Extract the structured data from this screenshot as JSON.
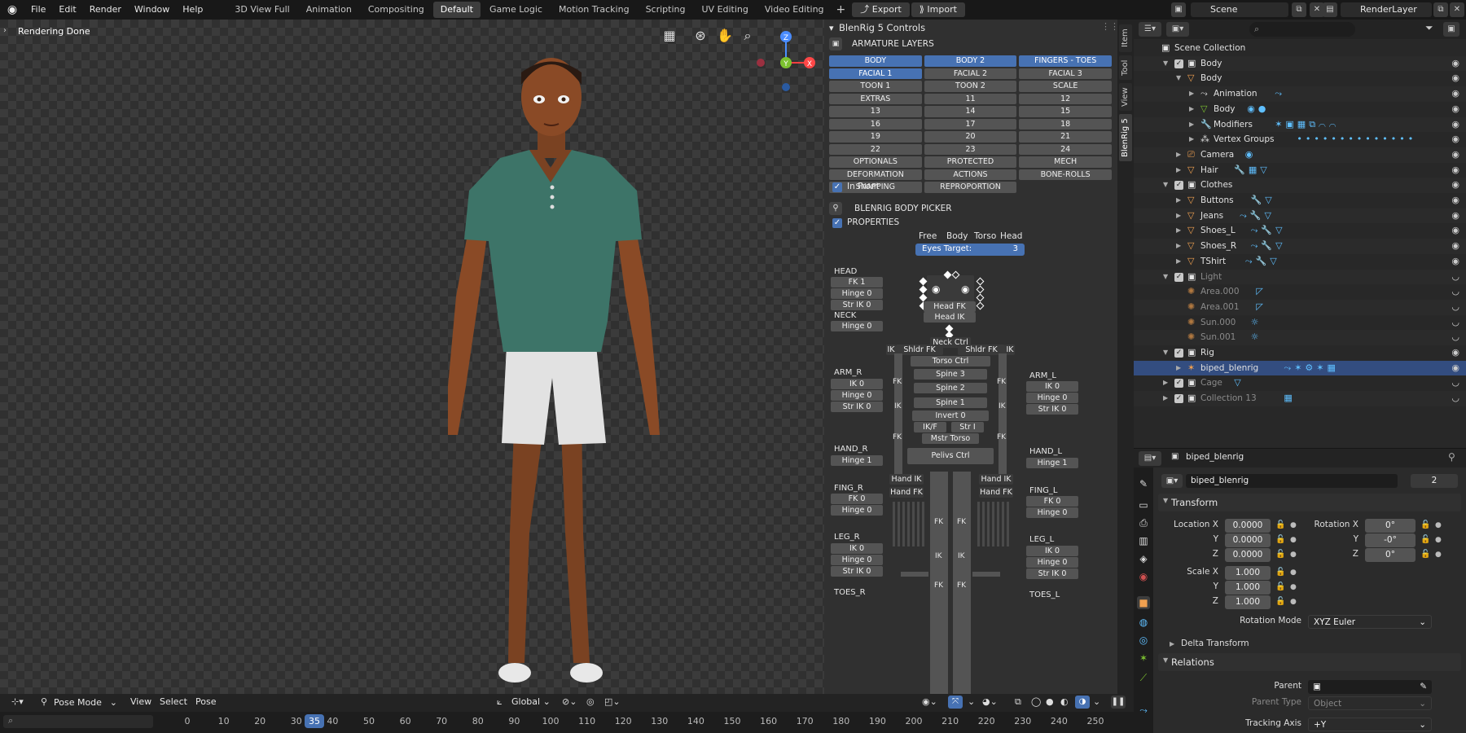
{
  "menu": [
    "File",
    "Edit",
    "Render",
    "Window",
    "Help"
  ],
  "workspaces": [
    "3D View Full",
    "Animation",
    "Compositing",
    "Default",
    "Game Logic",
    "Motion Tracking",
    "Scripting",
    "UV Editing",
    "Video Editing"
  ],
  "active_workspace": "Default",
  "toolbar_buttons": {
    "export": "Export",
    "import": "Import"
  },
  "scene": "Scene",
  "view_layer": "RenderLayer",
  "viewport": {
    "status": "Rendering Done",
    "gizmo": {
      "z": "Z",
      "y": "Y",
      "x": "X"
    }
  },
  "npanel": {
    "title": "BlenRig 5 Controls",
    "tabs": [
      "Item",
      "Tool",
      "View",
      "BlenRig 5"
    ],
    "armature_layers_title": "ARMATURE LAYERS",
    "layers": [
      {
        "label": "BODY",
        "on": true
      },
      {
        "label": "BODY 2",
        "on": true
      },
      {
        "label": "FINGERS - TOES",
        "on": true
      },
      {
        "label": "FACIAL 1",
        "on": true
      },
      {
        "label": "FACIAL 2",
        "on": false
      },
      {
        "label": "FACIAL 3",
        "on": false
      },
      {
        "label": "TOON 1",
        "on": false
      },
      {
        "label": "TOON 2",
        "on": false
      },
      {
        "label": "SCALE",
        "on": false
      },
      {
        "label": "EXTRAS",
        "on": false
      },
      {
        "label": "11",
        "on": false
      },
      {
        "label": "12",
        "on": false
      },
      {
        "label": "13",
        "on": false
      },
      {
        "label": "14",
        "on": false
      },
      {
        "label": "15",
        "on": false
      },
      {
        "label": "16",
        "on": false
      },
      {
        "label": "17",
        "on": false
      },
      {
        "label": "18",
        "on": false
      },
      {
        "label": "19",
        "on": false
      },
      {
        "label": "20",
        "on": false
      },
      {
        "label": "21",
        "on": false
      },
      {
        "label": "22",
        "on": false
      },
      {
        "label": "23",
        "on": false
      },
      {
        "label": "24",
        "on": false
      },
      {
        "label": "OPTIONALS",
        "on": false
      },
      {
        "label": "PROTECTED",
        "on": false
      },
      {
        "label": "MECH",
        "on": false
      },
      {
        "label": "DEFORMATION",
        "on": false
      },
      {
        "label": "ACTIONS",
        "on": false
      },
      {
        "label": "BONE-ROLLS",
        "on": false
      },
      {
        "label": "SNAPPING",
        "on": false
      },
      {
        "label": "REPROPORTION",
        "on": false
      }
    ],
    "in_front": "In Front",
    "body_picker_title": "BLENRIG BODY PICKER",
    "properties": "PROPERTIES",
    "view_tabs": [
      "Free",
      "Body",
      "Torso",
      "Head"
    ],
    "eyes_target_label": "Eyes Target:",
    "eyes_target_value": "3",
    "picker": {
      "head": "HEAD",
      "fk1": "FK 1",
      "hinge0": "Hinge 0",
      "strik0": "Str IK 0",
      "neck": "NECK",
      "neck_hinge": "Hinge 0",
      "arm_r": "ARM_R",
      "arm_r_ik": "IK 0",
      "arm_r_hinge": "Hinge 0",
      "arm_r_str": "Str IK 0",
      "hand_r": "HAND_R",
      "hand_r_hinge": "Hinge 1",
      "fing_r": "FING_R",
      "fing_r_fk": "FK 0",
      "fing_r_hinge": "Hinge 0",
      "leg_r": "LEG_R",
      "leg_r_ik": "IK 0",
      "leg_r_hinge": "Hinge 0",
      "leg_r_str": "Str IK 0",
      "toes_r": "TOES_R",
      "arm_l": "ARM_L",
      "arm_l_ik": "IK 0",
      "arm_l_hinge": "Hinge 0",
      "arm_l_str": "Str IK 0",
      "hand_l": "HAND_L",
      "hand_l_hinge": "Hinge 1",
      "fing_l": "FING_L",
      "fing_l_fk": "FK 0",
      "fing_l_hinge": "Hinge 0",
      "leg_l": "LEG_L",
      "leg_l_ik": "IK 0",
      "leg_l_hinge": "Hinge 0",
      "leg_l_str": "Str IK 0",
      "toes_l": "TOES_L",
      "head_fk": "Head FK",
      "head_ik": "Head IK",
      "neck_ctrl": "Neck Ctrl",
      "shldr_fk_r": "Shldr FK",
      "shldr_fk_l": "Shldr FK",
      "ik": "IK",
      "fk": "FK",
      "torso_ctrl": "Torso Ctrl",
      "spine3": "Spine 3",
      "spine2": "Spine 2",
      "spine1": "Spine 1",
      "invert": "Invert 0",
      "ikf": "IK/F",
      "str_i": "Str I",
      "mstr_torso": "Mstr Torso",
      "pelvis_ctrl": "Pelivs Ctrl",
      "hand_ik": "Hand IK",
      "hand_fk": "Hand FK"
    }
  },
  "outliner": {
    "search_placeholder": "",
    "rows": [
      {
        "label": "Scene Collection",
        "indent": 0,
        "icon": "collection",
        "check": false,
        "arrow": "",
        "dim": false,
        "tags": ""
      },
      {
        "label": "Body",
        "indent": 1,
        "icon": "collection",
        "check": true,
        "arrow": "▼",
        "dim": false,
        "tags": ""
      },
      {
        "label": "Body",
        "indent": 2,
        "icon": "mesh",
        "check": false,
        "arrow": "▼",
        "dim": false,
        "tags": ""
      },
      {
        "label": "Animation",
        "indent": 3,
        "icon": "anim",
        "check": false,
        "arrow": "▶",
        "dim": false,
        "tags": "⤳"
      },
      {
        "label": "Body",
        "indent": 3,
        "icon": "mesh-data",
        "check": false,
        "arrow": "▶",
        "dim": false,
        "tags": "◉●"
      },
      {
        "label": "Modifiers",
        "indent": 3,
        "icon": "wrench",
        "check": false,
        "arrow": "▶",
        "dim": false,
        "tags": "✶▣▦⧉⌒⌒"
      },
      {
        "label": "Vertex Groups",
        "indent": 3,
        "icon": "groups",
        "check": false,
        "arrow": "▶",
        "dim": false,
        "tags": "••••••••••••••"
      },
      {
        "label": "Camera",
        "indent": 2,
        "icon": "camera",
        "check": false,
        "arrow": "▶",
        "dim": false,
        "tags": "◉"
      },
      {
        "label": "Hair",
        "indent": 2,
        "icon": "mesh",
        "check": false,
        "arrow": "▶",
        "dim": false,
        "tags": "🔧▦▽"
      },
      {
        "label": "Clothes",
        "indent": 1,
        "icon": "collection",
        "check": true,
        "arrow": "▼",
        "dim": false,
        "tags": ""
      },
      {
        "label": "Buttons",
        "indent": 2,
        "icon": "mesh",
        "check": false,
        "arrow": "▶",
        "dim": false,
        "tags": "🔧▽"
      },
      {
        "label": "Jeans",
        "indent": 2,
        "icon": "mesh",
        "check": false,
        "arrow": "▶",
        "dim": false,
        "tags": "⤳🔧▽"
      },
      {
        "label": "Shoes_L",
        "indent": 2,
        "icon": "mesh",
        "check": false,
        "arrow": "▶",
        "dim": false,
        "tags": "⤳🔧▽"
      },
      {
        "label": "Shoes_R",
        "indent": 2,
        "icon": "mesh",
        "check": false,
        "arrow": "▶",
        "dim": false,
        "tags": "⤳🔧▽"
      },
      {
        "label": "TShirt",
        "indent": 2,
        "icon": "mesh",
        "check": false,
        "arrow": "▶",
        "dim": false,
        "tags": "⤳🔧▽"
      },
      {
        "label": "Light",
        "indent": 1,
        "icon": "collection",
        "check": true,
        "arrow": "▼",
        "dim": true,
        "tags": ""
      },
      {
        "label": "Area.000",
        "indent": 2,
        "icon": "light",
        "check": false,
        "arrow": "",
        "dim": true,
        "tags": "◸"
      },
      {
        "label": "Area.001",
        "indent": 2,
        "icon": "light",
        "check": false,
        "arrow": "",
        "dim": true,
        "tags": "◸"
      },
      {
        "label": "Sun.000",
        "indent": 2,
        "icon": "light",
        "check": false,
        "arrow": "",
        "dim": true,
        "tags": "☼"
      },
      {
        "label": "Sun.001",
        "indent": 2,
        "icon": "light",
        "check": false,
        "arrow": "",
        "dim": true,
        "tags": "☼"
      },
      {
        "label": "Rig",
        "indent": 1,
        "icon": "collection",
        "check": true,
        "arrow": "▼",
        "dim": false,
        "tags": ""
      },
      {
        "label": "biped_blenrig",
        "indent": 2,
        "icon": "armature",
        "check": false,
        "arrow": "▶",
        "dim": false,
        "tags": "⤳✶⚙✶▦",
        "selected": true
      },
      {
        "label": "Cage",
        "indent": 1,
        "icon": "collection",
        "check": true,
        "arrow": "▶",
        "dim": true,
        "tags": "▽"
      },
      {
        "label": "Collection 13",
        "indent": 1,
        "icon": "collection",
        "check": true,
        "arrow": "▶",
        "dim": true,
        "tags": "▦"
      }
    ]
  },
  "properties": {
    "header_object": "biped_blenrig",
    "datablock": "biped_blenrig",
    "users": "2",
    "transform": "Transform",
    "location_x_label": "Location X",
    "y_label": "Y",
    "z_label": "Z",
    "location": [
      "0.0000",
      "0.0000",
      "0.0000"
    ],
    "rotation_x_label": "Rotation X",
    "rotation": [
      "0°",
      "-0°",
      "0°"
    ],
    "scale_x_label": "Scale X",
    "scale": [
      "1.000",
      "1.000",
      "1.000"
    ],
    "rotation_mode_label": "Rotation Mode",
    "rotation_mode": "XYZ Euler",
    "delta_transform": "Delta Transform",
    "relations": "Relations",
    "parent_label": "Parent",
    "parent_type_label": "Parent Type",
    "parent_type": "Object",
    "tracking_axis_label": "Tracking Axis",
    "tracking_axis": "+Y"
  },
  "bottom": {
    "mode": "Pose Mode",
    "menus": [
      "View",
      "Select",
      "Pose"
    ],
    "orientation": "Global",
    "current_frame": "35",
    "ticks": [
      "0",
      "10",
      "20",
      "30",
      "40",
      "50",
      "60",
      "70",
      "80",
      "90",
      "100",
      "110",
      "120",
      "130",
      "140",
      "150",
      "160",
      "170",
      "180",
      "190",
      "200",
      "210",
      "220",
      "230",
      "240",
      "250"
    ]
  }
}
